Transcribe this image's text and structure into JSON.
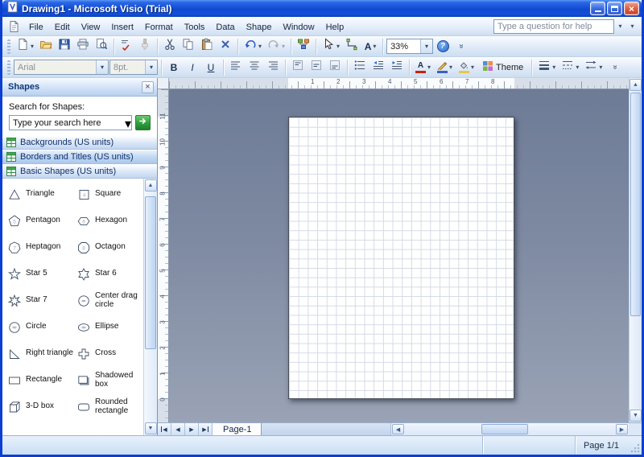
{
  "window": {
    "title": "Drawing1 - Microsoft Visio (Trial)"
  },
  "icons": {
    "window_close": "×",
    "dropdown_arrow": "▾",
    "panel_close": "×",
    "help": "?",
    "chevron_overflow": "»",
    "nav_first": "◀",
    "nav_prev": "◀",
    "nav_next": "▶",
    "nav_last": "▶",
    "scroll_up": "▲",
    "scroll_down": "▼",
    "scroll_left": "◀",
    "scroll_right": "▶"
  },
  "menubar": {
    "items": [
      "File",
      "Edit",
      "View",
      "Insert",
      "Format",
      "Tools",
      "Data",
      "Shape",
      "Window",
      "Help"
    ],
    "help_placeholder": "Type a question for help"
  },
  "toolbar_standard": {
    "zoom": "33%",
    "text_tool_label": "A"
  },
  "toolbar_formatting": {
    "font": "Arial",
    "size": "8pt.",
    "bold": "B",
    "italic": "I",
    "underline": "U",
    "font_color_label": "A",
    "theme": "Theme"
  },
  "shapes_panel": {
    "title": "Shapes",
    "search_label": "Search for Shapes:",
    "search_value": "Type your search here",
    "stencils": [
      {
        "label": "Backgrounds (US units)",
        "highlighted": false
      },
      {
        "label": "Borders and Titles (US units)",
        "highlighted": true
      },
      {
        "label": "Basic Shapes (US units)",
        "highlighted": false
      }
    ],
    "shapes": [
      {
        "label": "Triangle",
        "icon": "triangle-icon"
      },
      {
        "label": "Square",
        "icon": "square-icon",
        "badge": "4"
      },
      {
        "label": "Pentagon",
        "icon": "pentagon-icon",
        "badge": "5"
      },
      {
        "label": "Hexagon",
        "icon": "hexagon-icon",
        "badge": "6"
      },
      {
        "label": "Heptagon",
        "icon": "heptagon-icon",
        "badge": "7"
      },
      {
        "label": "Octagon",
        "icon": "octagon-icon",
        "badge": "8"
      },
      {
        "label": "Star 5",
        "icon": "star-5-icon"
      },
      {
        "label": "Star 6",
        "icon": "star-6-icon"
      },
      {
        "label": "Star 7",
        "icon": "star-7-icon"
      },
      {
        "label": "Center drag circle",
        "icon": "center-drag-circle-icon"
      },
      {
        "label": "Circle",
        "icon": "circle-icon"
      },
      {
        "label": "Ellipse",
        "icon": "ellipse-icon"
      },
      {
        "label": "Right triangle",
        "icon": "right-triangle-icon"
      },
      {
        "label": "Cross",
        "icon": "cross-icon"
      },
      {
        "label": "Rectangle",
        "icon": "rectangle-icon"
      },
      {
        "label": "Shadowed box",
        "icon": "shadowed-box-icon"
      },
      {
        "label": "3-D box",
        "icon": "3d-box-icon"
      },
      {
        "label": "Rounded rectangle",
        "icon": "rounded-rectangle-icon"
      }
    ]
  },
  "rulers": {
    "horizontal_numbers": [
      "1",
      "2",
      "3",
      "4",
      "5",
      "6",
      "7",
      "8"
    ],
    "vertical_numbers": [
      "11",
      "10",
      "9",
      "8",
      "7",
      "6",
      "5",
      "4",
      "3",
      "2",
      "1",
      "0"
    ]
  },
  "page_tabs": {
    "tabs": [
      {
        "label": "Page-1",
        "active": true
      }
    ]
  },
  "statusbar": {
    "page_indicator": "Page 1/1"
  },
  "colors": {
    "titlebar_blue": "#1049cf",
    "canvas_gray": "#7e8aa2",
    "stencil_green": "#2d8a3e"
  }
}
